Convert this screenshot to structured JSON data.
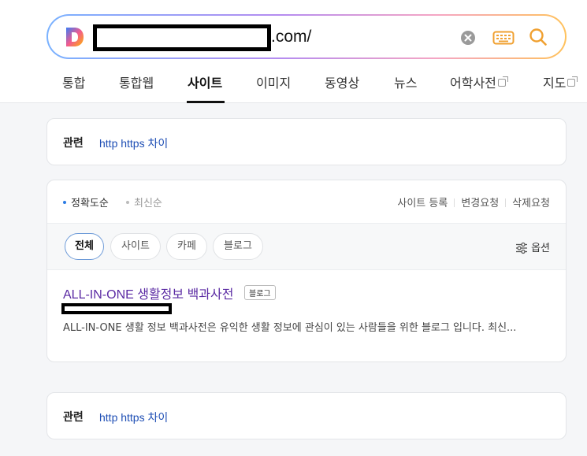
{
  "search": {
    "query_suffix": ".com/",
    "clear_label": "clear",
    "keyboard_label": "keyboard",
    "search_label": "search"
  },
  "tabs": [
    {
      "label": "통합"
    },
    {
      "label": "통합웹"
    },
    {
      "label": "사이트"
    },
    {
      "label": "이미지"
    },
    {
      "label": "동영상"
    },
    {
      "label": "뉴스"
    },
    {
      "label": "어학사전"
    },
    {
      "label": "지도"
    }
  ],
  "related_top": {
    "label": "관련",
    "link": "http https 차이"
  },
  "related_bottom": {
    "label": "관련",
    "link": "http https 차이"
  },
  "sort": {
    "options": [
      {
        "label": "정확도순"
      },
      {
        "label": "최신순"
      }
    ],
    "links": [
      {
        "label": "사이트 등록"
      },
      {
        "label": "변경요청"
      },
      {
        "label": "삭제요청"
      }
    ]
  },
  "filters": {
    "chips": [
      {
        "label": "전체"
      },
      {
        "label": "사이트"
      },
      {
        "label": "카페"
      },
      {
        "label": "블로그"
      }
    ],
    "options_label": "옵션"
  },
  "result": {
    "title": "ALL-IN-ONE 생활정보 백과사전",
    "badge": "블로그",
    "snippet": "ALL-IN-ONE 생활 정보 백과사전은 유익한 생활 정보에 관심이 있는 사람들을 위한 블로그 입니다. 최신..."
  },
  "colors": {
    "accent": "#2a7be4",
    "link": "#1f4fb5",
    "visited_title": "#5a2aa3"
  }
}
